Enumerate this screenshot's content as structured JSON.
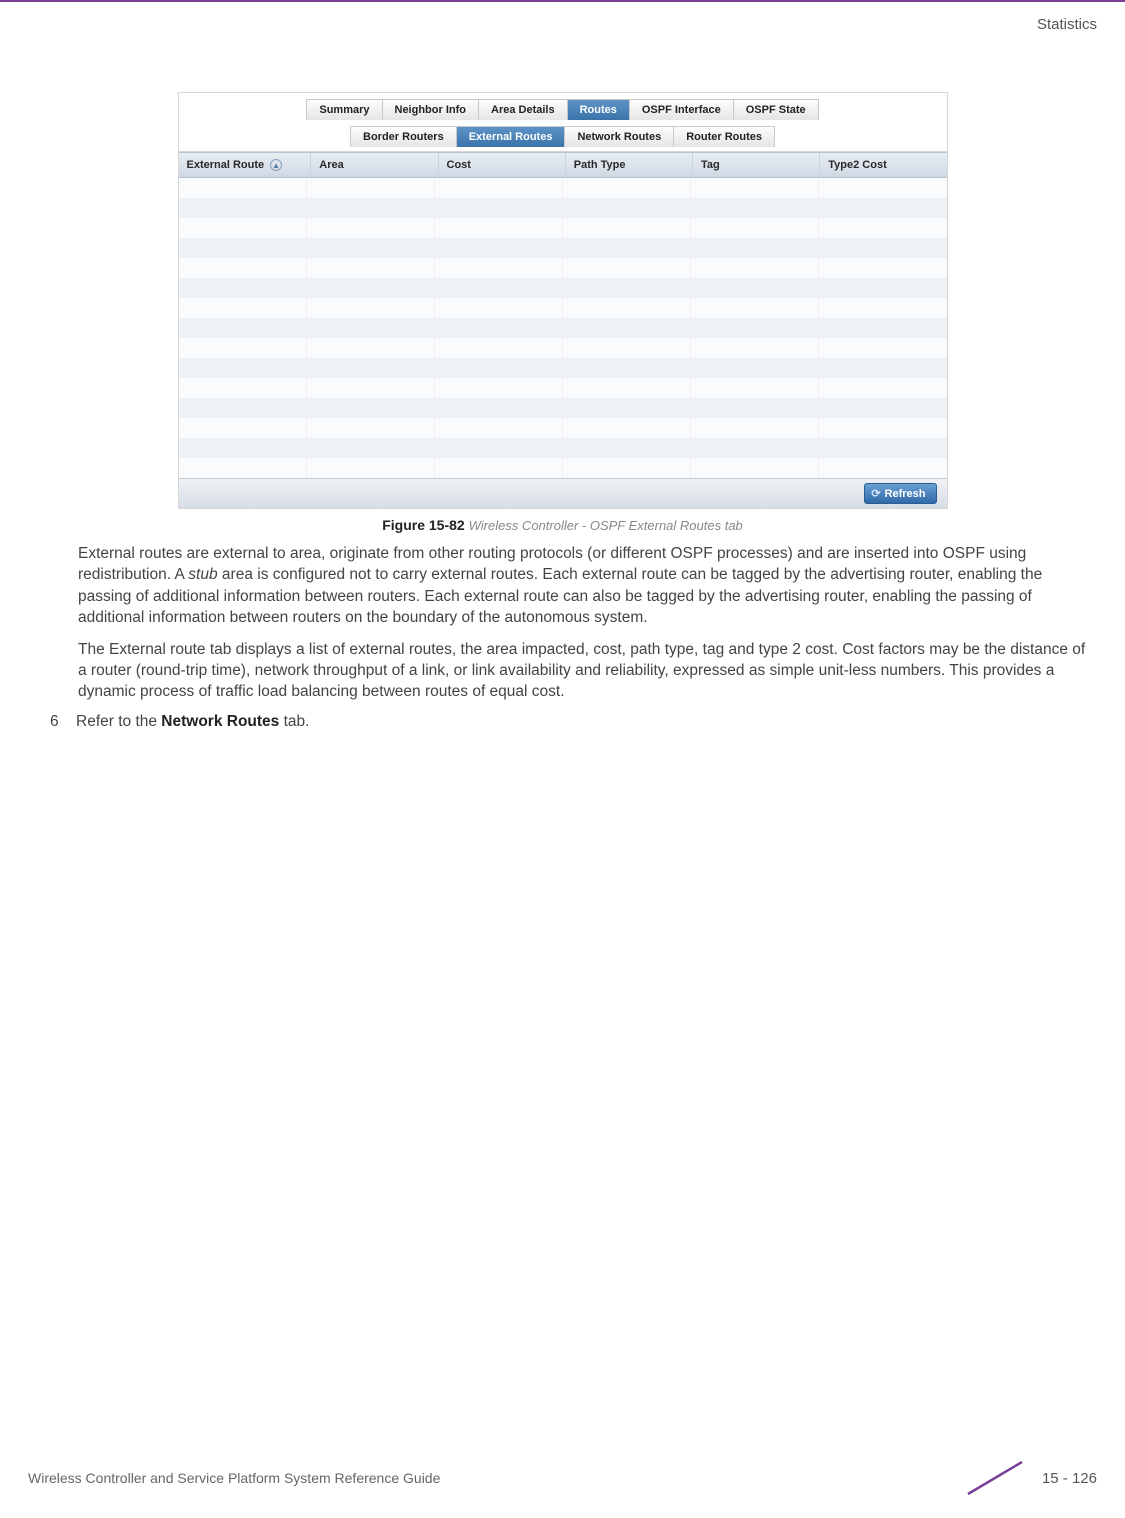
{
  "header": {
    "section_title": "Statistics"
  },
  "screenshot": {
    "tabs_primary": [
      {
        "label": "Summary",
        "active": false
      },
      {
        "label": "Neighbor Info",
        "active": false
      },
      {
        "label": "Area Details",
        "active": false
      },
      {
        "label": "Routes",
        "active": true
      },
      {
        "label": "OSPF Interface",
        "active": false
      },
      {
        "label": "OSPF State",
        "active": false
      }
    ],
    "tabs_secondary": [
      {
        "label": "Border Routers",
        "active": false
      },
      {
        "label": "External Routes",
        "active": true
      },
      {
        "label": "Network Routes",
        "active": false
      },
      {
        "label": "Router Routes",
        "active": false
      }
    ],
    "columns": [
      "External Route",
      "Area",
      "Cost",
      "Path Type",
      "Tag",
      "Type2 Cost"
    ],
    "refresh_label": "Refresh"
  },
  "figure": {
    "number": "Figure 15-82",
    "title": "Wireless Controller - OSPF External Routes tab"
  },
  "paragraphs": {
    "p1_a": "External routes are external to area, originate from other routing protocols (or different OSPF processes) and are inserted into OSPF using redistribution. A ",
    "p1_stub": "stub",
    "p1_b": " area is configured not to carry external routes. Each external route can be tagged by the advertising router, enabling the passing of additional information between routers. Each external route can also be tagged by the advertising router, enabling the passing of additional information between routers on the boundary of the autonomous system.",
    "p2": "The External route tab displays a list of external routes, the area impacted, cost, path type, tag and type 2 cost. Cost factors may be the distance of a router (round-trip time), network throughput of a link, or link availability and reliability, expressed as simple unit-less numbers. This provides a dynamic process of traffic load balancing between routes of equal cost."
  },
  "step": {
    "num": "6",
    "text_a": "Refer to the ",
    "bold": "Network Routes",
    "text_b": " tab."
  },
  "footer": {
    "guide_title": "Wireless Controller and Service Platform System Reference Guide",
    "page_number": "15 - 126"
  }
}
